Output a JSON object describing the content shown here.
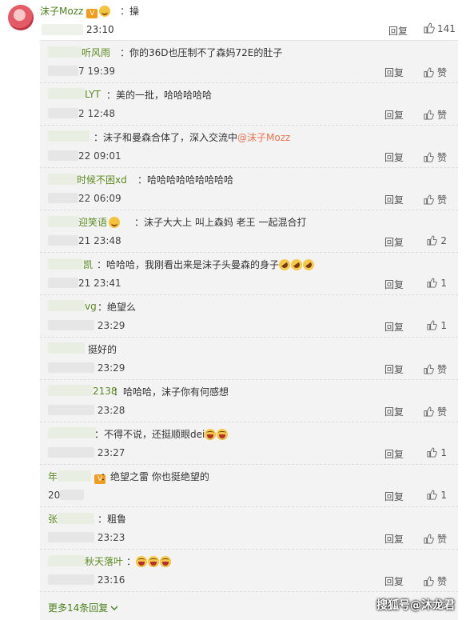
{
  "top_comment": {
    "username": "沫子Mozz",
    "text": "：操",
    "time": "23:10",
    "reply_label": "回复",
    "like_count": "141"
  },
  "replies": [
    {
      "name": "听风雨",
      "text": "：你的36D也压制不了森妈72E的肚子",
      "time": "7 19:39",
      "reply_label": "回复",
      "like": "赞"
    },
    {
      "name": "LYT",
      "text": "：美的一批，哈哈哈哈哈",
      "time": "2 12:48",
      "reply_label": "回复",
      "like": "赞"
    },
    {
      "name": "",
      "text": "：沫子和曼森合体了，深入交流中",
      "mention": "@沫子Mozz",
      "time": "22 09:01",
      "reply_label": "回复",
      "like": "赞"
    },
    {
      "name": "时候不困xd",
      "text": "：哈哈哈哈哈哈哈哈哈",
      "time": "22 06:09",
      "reply_label": "回复",
      "like": "赞"
    },
    {
      "name": "迎笑语",
      "text": "：沫子大大上  叫上森妈   老王  一起混合打",
      "time": "21 23:48",
      "reply_label": "回复",
      "like": "2"
    },
    {
      "name": "凯",
      "text": "：哈哈哈，我刚看出来是沫子头曼森的身子",
      "time": "21 23:41",
      "reply_label": "回复",
      "like": "1"
    },
    {
      "name": "vg",
      "text": "：绝望么",
      "time": "23:29",
      "reply_label": "回复",
      "like": "1"
    },
    {
      "name": "",
      "text": "挺好的",
      "time": "23:29",
      "reply_label": "回复",
      "like": "赞"
    },
    {
      "name": "2138",
      "text": "：哈哈哈，沫子你有何感想",
      "time": "23:28",
      "reply_label": "回复",
      "like": "赞"
    },
    {
      "name": "",
      "text": "：不得不说，还挺顺眼dei",
      "time": "23:27",
      "reply_label": "回复",
      "like": "1"
    },
    {
      "name": "年",
      "text": "：绝望之雷 你也挺绝望的",
      "time": "20",
      "reply_label": "回复",
      "like": "1"
    },
    {
      "name": "张",
      "text": "：粗鲁",
      "time": "23:23",
      "reply_label": "回复",
      "like": "赞"
    },
    {
      "name": "秋天落叶",
      "text": "：",
      "time": "23:16",
      "reply_label": "回复",
      "like": "赞"
    }
  ],
  "more_replies": "更多14条回复",
  "watermark": "搜狐号@沐龙君",
  "colors": {
    "name_green": "#5b8a1f",
    "mention_orange": "#eb7350",
    "panel_bg": "#f3f3f3"
  }
}
